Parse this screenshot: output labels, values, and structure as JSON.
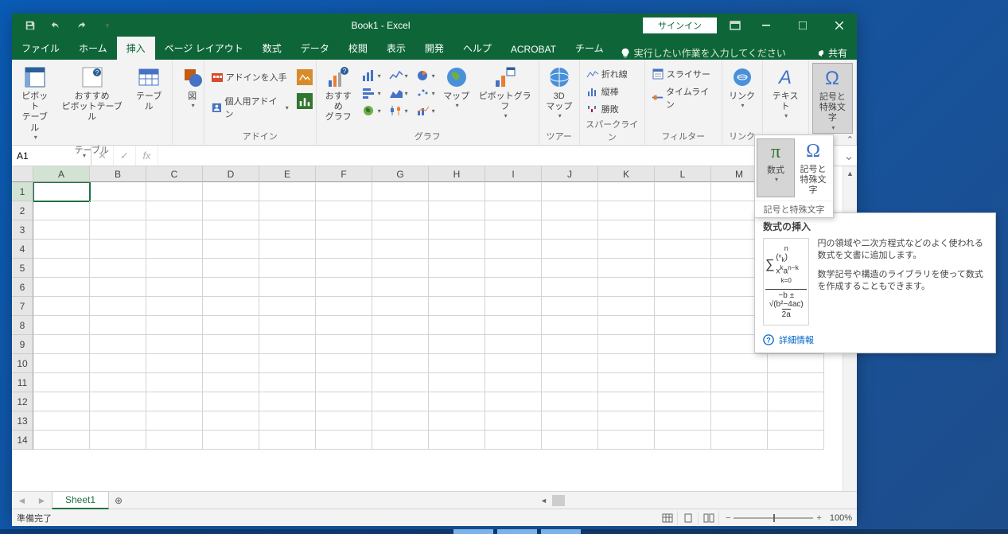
{
  "title": "Book1 - Excel",
  "signin": "サインイン",
  "share": "共有",
  "tabs": [
    "ファイル",
    "ホーム",
    "挿入",
    "ページ レイアウト",
    "数式",
    "データ",
    "校閲",
    "表示",
    "開発",
    "ヘルプ",
    "ACROBAT",
    "チーム"
  ],
  "active_tab": "挿入",
  "tell_me": "実行したい作業を入力してください",
  "ribbon": {
    "tables": {
      "label": "テーブル",
      "pivot": "ピボット\nテーブル",
      "recommended_pivot": "おすすめ\nピボットテーブル",
      "table": "テーブル"
    },
    "illustrations": {
      "label": "図",
      "shapes": "図"
    },
    "addins": {
      "label": "アドイン",
      "get": "アドインを入手",
      "my": "個人用アドイン"
    },
    "charts": {
      "label": "グラフ",
      "recommended": "おすすめ\nグラフ",
      "maps": "マップ",
      "pivot_chart": "ピボットグラフ"
    },
    "tours": {
      "label": "ツアー",
      "map3d": "3D\nマップ"
    },
    "sparklines": {
      "label": "スパークライン",
      "line": "折れ線",
      "column": "縦棒",
      "winloss": "勝敗"
    },
    "filters": {
      "label": "フィルター",
      "slicer": "スライサー",
      "timeline": "タイムライン"
    },
    "links": {
      "label": "リンク",
      "link": "リンク"
    },
    "text": {
      "label": "テキスト",
      "text": "テキスト"
    },
    "symbols": {
      "label": "記号と特殊文字",
      "equation": "数式",
      "symbol": "記号と\n特殊文字"
    }
  },
  "popup": {
    "equation": "数式",
    "symbol": "記号と\n特殊文字",
    "group_label": "記号と特殊文字"
  },
  "tooltip": {
    "title": "数式の挿入",
    "p1": "円の領域や二次方程式などのよく使われる数式を文書に追加します。",
    "p2": "数学記号や構造のライブラリを使って数式を作成することもできます。",
    "more": "詳細情報"
  },
  "name_box": "A1",
  "columns": [
    "A",
    "B",
    "C",
    "D",
    "E",
    "F",
    "G",
    "H",
    "I",
    "J",
    "K",
    "L",
    "M"
  ],
  "rows": [
    "1",
    "2",
    "3",
    "4",
    "5",
    "6",
    "7",
    "8",
    "9",
    "10",
    "11",
    "12",
    "13",
    "14"
  ],
  "sheet": "Sheet1",
  "status": "準備完了",
  "zoom": "100%"
}
